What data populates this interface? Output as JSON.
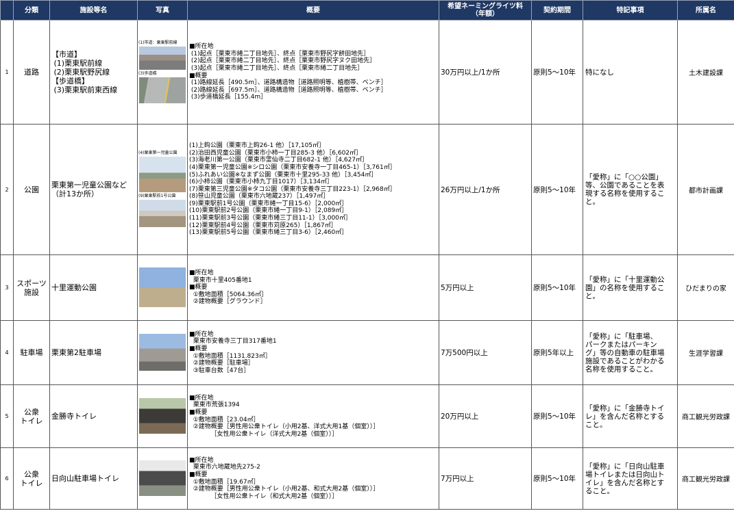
{
  "headers": {
    "no": "",
    "category": "分類",
    "facility": "施設等名",
    "photo": "写真",
    "overview": "概要",
    "fee_line1": "希望ネーミングライツ料",
    "fee_line2": "（年額）",
    "term": "契約期間",
    "notes": "特記事項",
    "dept": "所属名"
  },
  "rows": [
    {
      "no": "1",
      "category": "道路",
      "name_lines": [
        "【市道】",
        " (1)栗東駅前線",
        " (2)栗東駅野尻線",
        "【歩道橋】",
        " (3)栗東駅前東西線"
      ],
      "captions": [
        "(1)市道：栗東駅前線",
        "(3)歩道橋"
      ],
      "overview": [
        "■所在地",
        " (1)起点［栗東市綣二丁目地先］、終点［栗東市野尻字餅田地先］",
        " (2)起点［栗東市綣二丁目地先］、終点［栗東市野尻字ヌク田地先］",
        " (3)起点［栗東市綣二丁目地先］、終点［栗東市綣二丁目地先］",
        "■概要",
        " (1)路線延長［490.5m］、道路構造物［道路照明等、植樹帯、ベンチ］",
        " (2)路線延長［697.5m］、道路構造物［道路照明等、植樹帯、ベンチ］",
        " (3)歩道橋延長［155.4m］"
      ],
      "fee": "30万円以上/1か所",
      "term": "原則5～10年",
      "note": [
        "特になし"
      ],
      "dept": "土木建設課"
    },
    {
      "no": "2",
      "category": "公園",
      "name_lines": [
        "栗東第一児童公園など",
        "（計13か所）"
      ],
      "captions": [
        "(4)栗東第一児童公園",
        "(9)栗東駅前1号公園"
      ],
      "overview": [
        "(1)上鈎公園（栗東市上鈎26-1 他）［17,105㎡］",
        "(2)治田西児童公園（栗東市小柿一丁目285-3 他）［6,602㎡］",
        "(3)海老川第一公園（栗東市霊仙寺二丁目682-1 他）［4,627㎡］",
        "(4)栗東第一児童公園※シロ公園（栗東市安養寺一丁目465-1）［3,761㎡］",
        "(5)ふれあい公園※なまず公園（栗東市十里295-33 他）［3,454㎡］",
        "(6)小柿公園（栗東市小柿九丁目1017）［3,134㎡］",
        "(7)栗東第三児童公園※タコ公園（栗東市安養寺三丁目223-1）［2,968㎡］",
        "(8)笹山児童公園（栗東市六地蔵237）［1,497㎡］",
        "(9)栗東駅前1号公園（栗東市綣一丁目15-6）［2,000㎡］",
        "(10)栗東駅前2号公園（栗東市綣一丁目9-1）［2,089㎡］",
        "(11)栗東駅前3号公園（栗東市綣三丁目11-1）［3,000㎡］",
        "(12)栗東駅前4号公園（栗東市苅原265）［1,867㎡］",
        "(13)栗東駅前5号公園（栗東市綣三丁目3-6）［2,460㎡］"
      ],
      "fee": "26万円以上/1か所",
      "term": "原則5～10年",
      "note": [
        "「愛称」に「○○公園」",
        "等、公園であることを表",
        "現する名称を使用するこ",
        "と。"
      ],
      "dept": "都市計画課"
    },
    {
      "no": "3",
      "category_lines": [
        "スポーツ",
        "施設"
      ],
      "name_lines": [
        "十里運動公園"
      ],
      "overview": [
        "■所在地",
        "  栗東市十里405番地1",
        "■概要",
        "  ①敷地面積［5064.36㎡］",
        "  ②建物概要［グラウンド］"
      ],
      "fee": "5万円以上",
      "term": "原則5～10年",
      "note": [
        "「愛称」に「十里運動公",
        "園」の名称を使用するこ",
        "と。"
      ],
      "dept": "ひだまりの家"
    },
    {
      "no": "4",
      "category": "駐車場",
      "name_lines": [
        "栗東第2駐車場"
      ],
      "overview": [
        "■所在地",
        "  栗東市安養寺三丁目317番地1",
        "■概要",
        "  ①敷地面積［1131.823㎡］",
        "  ②建物概要［駐車場］",
        "  ③駐車台数［47台］"
      ],
      "fee": "7万500円以上",
      "term": "原則5年以上",
      "note": [
        "「愛称」に「駐車場、",
        "パークまたはパーキン",
        "グ」等の自動車の駐車場",
        "施設であることがわかる",
        "名称を使用すること。"
      ],
      "dept": "生涯学習課"
    },
    {
      "no": "5",
      "category_lines": [
        "公衆",
        "トイレ"
      ],
      "name_lines": [
        "金勝寺トイレ"
      ],
      "overview": [
        "■所在地",
        "  栗東市荒張1394",
        "■概要",
        "  ①敷地面積［23.04㎡］",
        "  ②建物概要［男性用公衆トイレ（小用2基、洋式大用1基（個室））］",
        "           ［女性用公衆トイレ（洋式大用2基（個室））］"
      ],
      "fee": "20万円以上",
      "term": "原則5～10年",
      "note": [
        "「愛称」に「金勝寺トイ",
        "レ」を含んだ名称とする",
        "こと。"
      ],
      "dept": "商工観光労政課"
    },
    {
      "no": "6",
      "category_lines": [
        "公衆",
        "トイレ"
      ],
      "name_lines": [
        "日向山駐車場トイレ"
      ],
      "overview": [
        "■所在地",
        "  栗東市六地蔵地先275-2",
        "■概要",
        "  ①敷地面積［19.67㎡］",
        "  ②建物概要［男性用公衆トイレ（小用2基、和式大用2基（個室））］",
        "           ［女性用公衆トイレ（和式大用2基（個室））］"
      ],
      "fee": "7万円以上",
      "term": "原則5～10年",
      "note": [
        "「愛称」に「日向山駐車",
        "場トイレまたは日向山ト",
        "イレ」を含んだ名称とす",
        "ること。"
      ],
      "dept": "商工観光労政課"
    }
  ]
}
